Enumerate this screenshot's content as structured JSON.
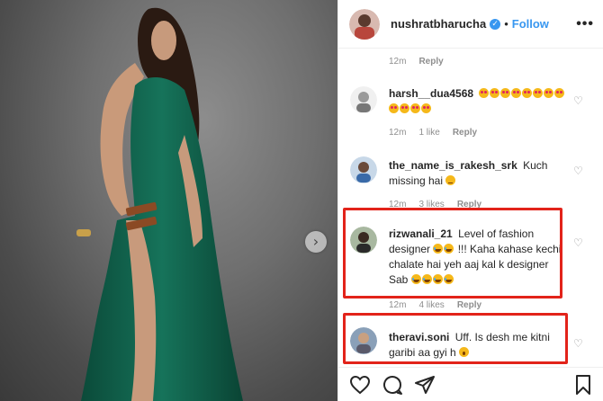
{
  "post": {
    "username": "nushratbharucha",
    "verified_icon": "verified-badge-icon",
    "separator": "•",
    "follow_label": "Follow",
    "more_label": "•••"
  },
  "top_meta": {
    "time": "12m",
    "reply": "Reply"
  },
  "comments": [
    {
      "username": "harsh__dua4568",
      "text_emojis": [
        "heart-eyes",
        "heart-eyes",
        "heart-eyes",
        "heart-eyes",
        "heart-eyes",
        "heart-eyes",
        "heart-eyes",
        "heart-eyes",
        "heart-eyes",
        "heart-eyes",
        "heart-eyes",
        "heart-eyes"
      ],
      "time": "12m",
      "likes": "1 like",
      "reply": "Reply"
    },
    {
      "username": "the_name_is_rakesh_srk",
      "text": "Kuch missing hai",
      "trailing_emoji": "thinking-face",
      "time": "12m",
      "likes": "3 likes",
      "reply": "Reply"
    },
    {
      "username": "rizwanali_21",
      "text_a": "Level of fashion designer",
      "text_b": "!!! Kaha kahase kechi chalate hai yeh aaj kal k designer Sab",
      "time": "12m",
      "likes": "4 likes",
      "reply": "Reply"
    },
    {
      "username": "theravi.soni",
      "text": "Uff. Is desh me kitni garibi aa gyi h"
    }
  ],
  "colors": {
    "accent": "#3897f0",
    "highlight": "#e2231a",
    "dress": "#0f5a45"
  }
}
